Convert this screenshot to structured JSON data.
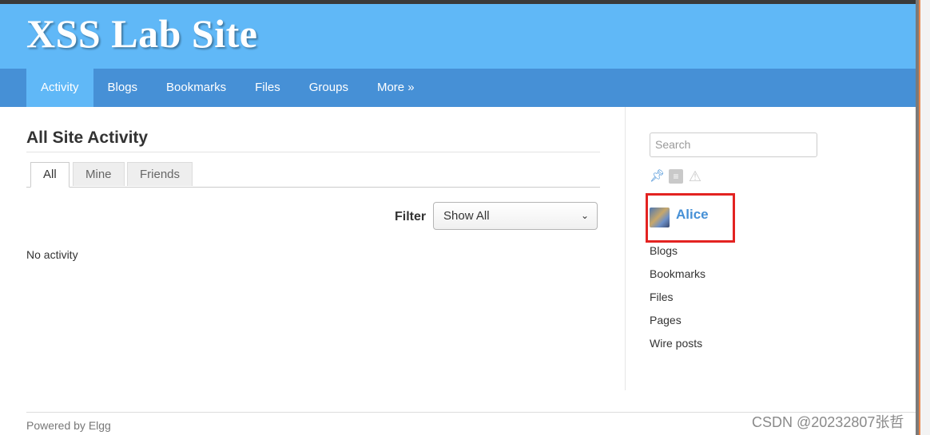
{
  "header": {
    "site_title": "XSS Lab Site"
  },
  "nav": {
    "items": [
      {
        "label": "Activity",
        "active": true
      },
      {
        "label": "Blogs"
      },
      {
        "label": "Bookmarks"
      },
      {
        "label": "Files"
      },
      {
        "label": "Groups"
      },
      {
        "label": "More »"
      }
    ]
  },
  "main": {
    "title": "All Site Activity",
    "tabs": [
      {
        "label": "All",
        "active": true
      },
      {
        "label": "Mine"
      },
      {
        "label": "Friends"
      }
    ],
    "filter_label": "Filter",
    "filter_value": "Show All",
    "empty_message": "No activity"
  },
  "sidebar": {
    "search_placeholder": "Search",
    "icons": [
      "pin-icon",
      "rss-icon",
      "warning-icon"
    ],
    "owner_name": "Alice",
    "owner_menu": [
      "Blogs",
      "Bookmarks",
      "Files",
      "Pages",
      "Wire posts"
    ]
  },
  "footer": {
    "powered_by": "Powered by Elgg"
  },
  "watermark": "CSDN @20232807张哲",
  "colors": {
    "header_bg": "#60b8f7",
    "nav_bg": "#4690d6",
    "link": "#4690d6",
    "highlight_box": "#e32321"
  }
}
